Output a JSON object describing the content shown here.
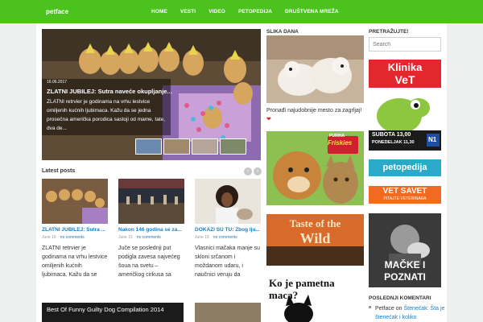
{
  "header": {
    "logo": "petface",
    "nav": [
      "HOME",
      "VESTI",
      "VIDEO",
      "PETOPEDIJA",
      "DRUŠTVENA MREŽA"
    ]
  },
  "slider": {
    "date": "16.06.2017",
    "title": "ZLATNI JUBILEJ: Sutra naveće okupljanje...",
    "excerpt": "ZLATNI retrvier je godinama na vrhu lestvice omiljenih kućnih ljubimaca. Kažu da se jedna prosečna američka porodica sastoji od mame, tate, dva de..."
  },
  "latest": {
    "title": "Latest posts",
    "prev": "‹",
    "next": "›",
    "posts": [
      {
        "title": "ZLATNI JUBILEJ: Sutra ...",
        "date": "June 16",
        "comments": "no comments",
        "text": "ZLATNI retrvier je godinama na vrhu lestvice omiljenih kućnih ljubimaca. Kažu da se"
      },
      {
        "title": "Nakon 146 godina se za...",
        "date": "June 15",
        "comments": "no comments",
        "text": "Juče se poslednji put podigla zavesa najvećeg šoua na svetu – američkog cirkusa sa"
      },
      {
        "title": "DOKAZI SU TU: Zbog lju...",
        "date": "June 15",
        "comments": "no comments",
        "text": "Vlasnici mačaka manje su skloni srčanom i moždanom udaru, i naučnici veruju da"
      }
    ],
    "video_title": "Best Of Funny Guilty Dog Compilation 2014"
  },
  "middle": {
    "title": "SLIKA DANA",
    "caption": "Pronađi najudobnije mesto za zagrljaj!",
    "heart": "❤",
    "friskies_brand": "PURINA",
    "friskies_name": "Friskies",
    "wild_line1": "Taste of the",
    "wild_line2": "Wild",
    "pametna": "Ko je pametna maca?"
  },
  "sidebar": {
    "search_title": "PRETRAŽUJTE!",
    "search_placeholder": "Search",
    "klinika_line1": "Klinika",
    "klinika_line2": "VeT",
    "klinika_hours1": "SUBOTA 13,00",
    "klinika_hours2": "PONEDELJAK 11,30",
    "klinika_channel": "N1",
    "petopedija": "petopedija",
    "vetsavet": "VET SAVET",
    "vetsavet_sub": "PITAJTE VETERINARA",
    "macke_line1": "MAČKE I",
    "macke_line2": "POZNATI",
    "recent_title": "POSLEDNJI KOMENTARI",
    "recent_author": "Petface",
    "recent_on": "on",
    "recent_link": "Štenećak: Šta je štenećak i koliko"
  }
}
